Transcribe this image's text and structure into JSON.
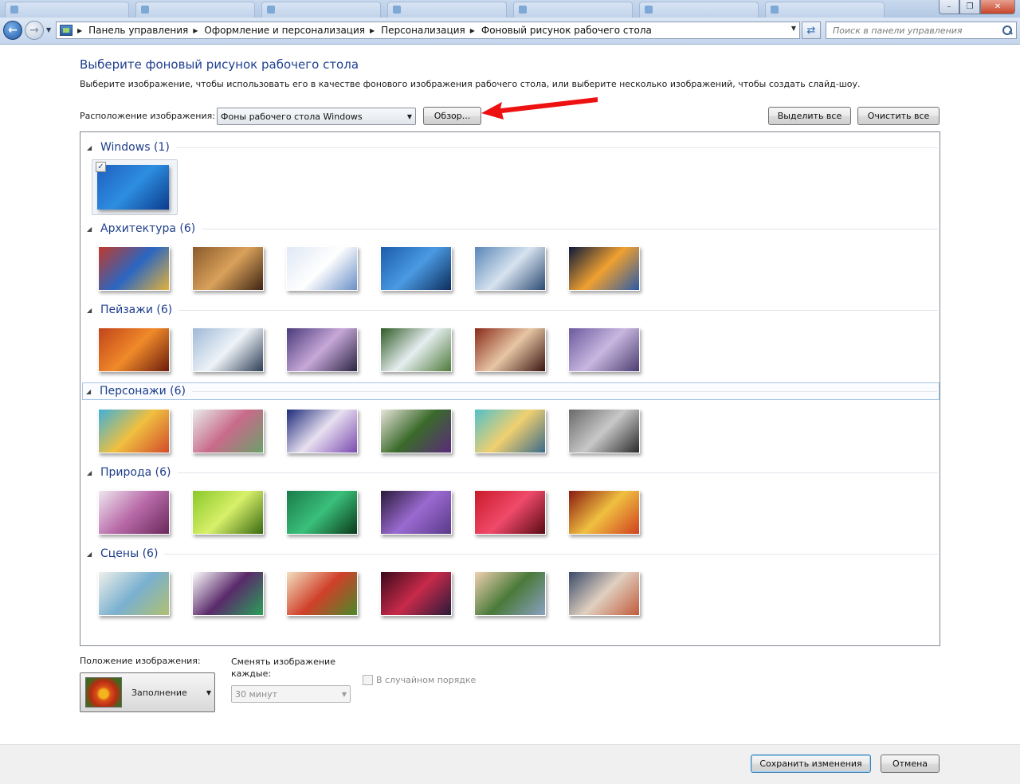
{
  "window": {
    "minimize_glyph": "–",
    "restore_glyph": "❐",
    "close_glyph": "✕"
  },
  "address_bar": {
    "breadcrumbs": [
      "Панель управления",
      "Оформление и персонализация",
      "Персонализация",
      "Фоновый рисунок рабочего стола"
    ],
    "search_placeholder": "Поиск в панели управления"
  },
  "header": {
    "title": "Выберите фоновый рисунок рабочего стола",
    "subtitle": "Выберите изображение, чтобы использовать его в качестве фонового изображения рабочего стола, или выберите несколько изображений, чтобы создать слайд-шоу."
  },
  "location": {
    "label": "Расположение изображения:",
    "selected": "Фоны рабочего стола Windows",
    "browse_label": "Обзор...",
    "select_all_label": "Выделить все",
    "clear_all_label": "Очистить все"
  },
  "groups": [
    {
      "name": "Windows (1)",
      "thumbs": 1,
      "checked": [
        0
      ],
      "colors": [
        [
          "#1f5fbf",
          "#2d8ee0",
          "#0b3a8c"
        ]
      ]
    },
    {
      "name": "Архитектура (6)",
      "thumbs": 6,
      "colors": [
        [
          "#c0392b",
          "#2a66c2",
          "#e3b23c"
        ],
        [
          "#8a5a2b",
          "#d9a15a",
          "#3d2412"
        ],
        [
          "#dfe8f5",
          "#ffffff",
          "#6a8fc7"
        ],
        [
          "#1c5cab",
          "#4a9ae2",
          "#0d2d5c"
        ],
        [
          "#5a86b8",
          "#d7e3ef",
          "#2b4a73"
        ],
        [
          "#0b1a3a",
          "#f0a030",
          "#2a5aa8"
        ]
      ]
    },
    {
      "name": "Пейзажи (6)",
      "thumbs": 6,
      "colors": [
        [
          "#c1441a",
          "#f08a2a",
          "#6b1c0c"
        ],
        [
          "#9fb9d6",
          "#eef3f8",
          "#2d3d55"
        ],
        [
          "#4a3a7a",
          "#c7a8d8",
          "#2a2442"
        ],
        [
          "#2f5a26",
          "#e6eef0",
          "#4e7a3a"
        ],
        [
          "#8a2a1a",
          "#e7c6a5",
          "#3a1410"
        ],
        [
          "#6b5a9e",
          "#c9b7e0",
          "#4a3d6f"
        ]
      ]
    },
    {
      "name": "Персонажи (6)",
      "thumbs": 6,
      "colors": [
        [
          "#3fb0d8",
          "#f0c040",
          "#d24a2a"
        ],
        [
          "#e9ecea",
          "#c86a8a",
          "#6aa06a"
        ],
        [
          "#1c2a7a",
          "#e8e0f0",
          "#7a4ab0"
        ],
        [
          "#e8e4da",
          "#3a6a2a",
          "#5a2a7a"
        ],
        [
          "#52c0c8",
          "#f0d070",
          "#3a6a8a"
        ],
        [
          "#6a6a6a",
          "#c8c8c8",
          "#2a2a2a"
        ]
      ]
    },
    {
      "name": "Природа (6)",
      "thumbs": 6,
      "colors": [
        [
          "#efe6ef",
          "#b86aa8",
          "#6a2a5a"
        ],
        [
          "#8ac82a",
          "#d8f06a",
          "#3a6a10"
        ],
        [
          "#1a7a4a",
          "#3ac07a",
          "#0a3a1a"
        ],
        [
          "#2a1a3a",
          "#9a6ad0",
          "#5a3a8a"
        ],
        [
          "#c81a2a",
          "#f04a6a",
          "#5a0a14"
        ],
        [
          "#8a1a10",
          "#f0c040",
          "#d04020"
        ]
      ]
    },
    {
      "name": "Сцены (6)",
      "thumbs": 6,
      "colors": [
        [
          "#eef0ea",
          "#7ab0d0",
          "#b0c070"
        ],
        [
          "#ffffff",
          "#5a2a6a",
          "#2aa05a"
        ],
        [
          "#f2e0c0",
          "#d0402a",
          "#4a8a2a"
        ],
        [
          "#3a0a1a",
          "#c82a4a",
          "#2a1a3a"
        ],
        [
          "#f0d0b0",
          "#4a7a3a",
          "#8aa0c0"
        ],
        [
          "#3a4a6a",
          "#e0d0c0",
          "#c05a3a"
        ]
      ]
    }
  ],
  "position": {
    "label": "Положение изображения:",
    "selected": "Заполнение"
  },
  "interval": {
    "label": "Сменять изображение каждые:",
    "selected": "30 минут"
  },
  "shuffle": {
    "label": "В случайном порядке",
    "checked": false
  },
  "footer": {
    "save_label": "Сохранить изменения",
    "cancel_label": "Отмена"
  }
}
